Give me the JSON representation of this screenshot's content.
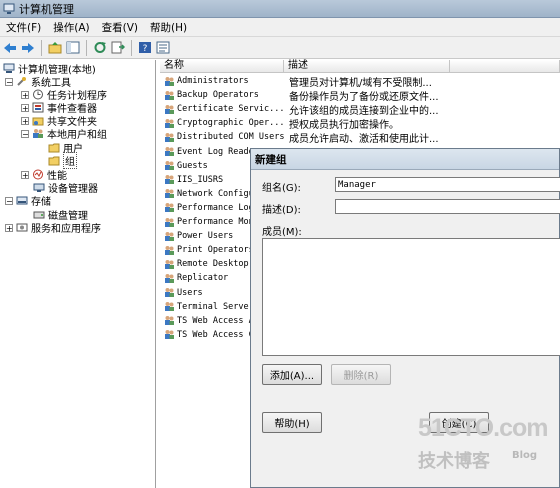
{
  "window": {
    "title": "计算机管理"
  },
  "menu": [
    "文件(F)",
    "操作(A)",
    "查看(V)",
    "帮助(H)"
  ],
  "tree": {
    "root": "计算机管理(本地)",
    "system_tools": "系统工具",
    "task_scheduler": "任务计划程序",
    "event_viewer": "事件查看器",
    "shared_folders": "共享文件夹",
    "local_users_groups": "本地用户和组",
    "users": "用户",
    "groups": "组",
    "performance": "性能",
    "device_manager": "设备管理器",
    "storage": "存储",
    "disk_management": "磁盘管理",
    "services_apps": "服务和应用程序"
  },
  "list": {
    "col_name": "名称",
    "col_desc": "描述",
    "rows": [
      {
        "name": "Administrators",
        "desc": "管理员对计算机/域有不受限制..."
      },
      {
        "name": "Backup Operators",
        "desc": "备份操作员为了备份或还原文件..."
      },
      {
        "name": "Certificate Servic...",
        "desc": "允许该组的成员连接到企业中的..."
      },
      {
        "name": "Cryptographic Oper...",
        "desc": "授权成员执行加密操作。"
      },
      {
        "name": "Distributed COM Users",
        "desc": "成员允许启动、激活和使用此计..."
      },
      {
        "name": "Event Log Readers",
        "desc": ""
      },
      {
        "name": "Guests",
        "desc": ""
      },
      {
        "name": "IIS_IUSRS",
        "desc": ""
      },
      {
        "name": "Network Configurat",
        "desc": ""
      },
      {
        "name": "Performance Log Users",
        "desc": ""
      },
      {
        "name": "Performance Monitor",
        "desc": ""
      },
      {
        "name": "Power Users",
        "desc": ""
      },
      {
        "name": "Print Operators",
        "desc": ""
      },
      {
        "name": "Remote Desktop Users",
        "desc": ""
      },
      {
        "name": "Replicator",
        "desc": ""
      },
      {
        "name": "Users",
        "desc": ""
      },
      {
        "name": "Terminal Server",
        "desc": ""
      },
      {
        "name": "TS Web Access A",
        "desc": ""
      },
      {
        "name": "TS Web Access C",
        "desc": ""
      }
    ]
  },
  "dialog": {
    "title": "新建组",
    "group_name_label": "组名(G):",
    "group_name_value": "Manager",
    "desc_label": "描述(D):",
    "desc_value": "",
    "members_label": "成员(M):",
    "add_button": "添加(A)...",
    "remove_button": "删除(R)",
    "help_button": "帮助(H)",
    "create_button": "创建(C)"
  },
  "watermark": {
    "site": "51CTO.com",
    "line2": "技术博客",
    "blog": "Blog"
  }
}
